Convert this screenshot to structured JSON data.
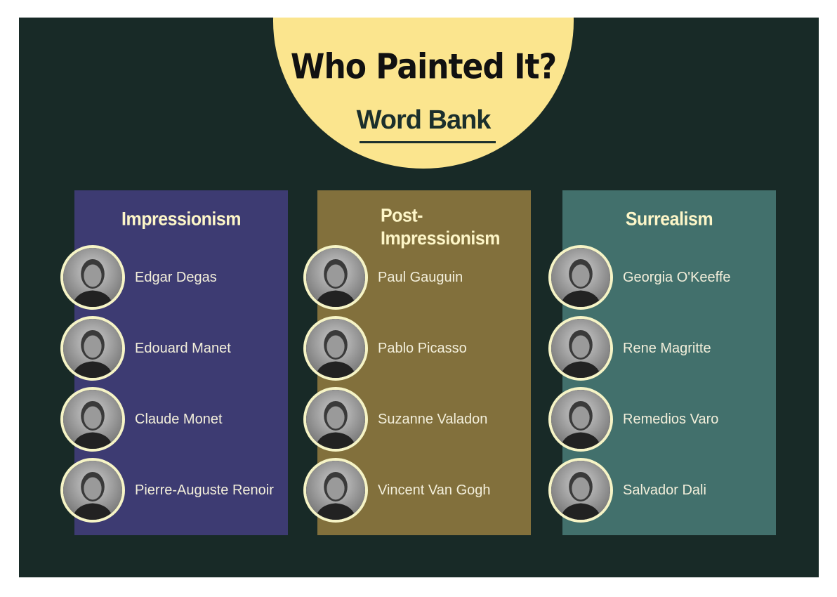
{
  "header": {
    "title": "Who Painted It?",
    "subtitle": "Word Bank"
  },
  "colors": {
    "board": "#182a27",
    "sun": "#fbe58e",
    "impressionism": "#3d3b72",
    "post_impressionism": "#82703c",
    "surrealism": "#42706c",
    "portrait_ring": "#f6f4c6"
  },
  "columns": [
    {
      "title": "Impressionism",
      "artists": [
        {
          "name": "Edgar Degas",
          "icon": "portrait-photo-icon"
        },
        {
          "name": "Edouard Manet",
          "icon": "portrait-photo-icon"
        },
        {
          "name": "Claude Monet",
          "icon": "portrait-photo-icon"
        },
        {
          "name": "Pierre-Auguste Renoir",
          "icon": "portrait-photo-icon"
        }
      ]
    },
    {
      "title": "Post-Impressionism",
      "title_lines": [
        "Post-",
        "Impressionism"
      ],
      "artists": [
        {
          "name": "Paul Gauguin",
          "icon": "portrait-photo-icon"
        },
        {
          "name": "Pablo Picasso",
          "icon": "portrait-photo-icon"
        },
        {
          "name": "Suzanne Valadon",
          "icon": "portrait-photo-icon"
        },
        {
          "name": "Vincent Van Gogh",
          "icon": "portrait-photo-icon"
        }
      ]
    },
    {
      "title": "Surrealism",
      "artists": [
        {
          "name": "Georgia O'Keeffe",
          "icon": "portrait-photo-icon"
        },
        {
          "name": "Rene Magritte",
          "icon": "portrait-photo-icon"
        },
        {
          "name": "Remedios Varo",
          "icon": "portrait-photo-icon"
        },
        {
          "name": "Salvador Dali",
          "icon": "portrait-photo-icon"
        }
      ]
    }
  ]
}
